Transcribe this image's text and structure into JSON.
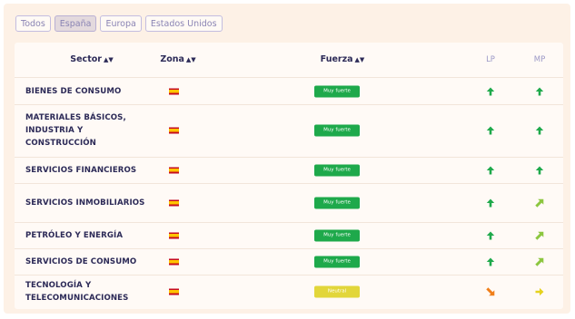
{
  "filters": [
    {
      "label": "Todos",
      "active": false
    },
    {
      "label": "España",
      "active": true
    },
    {
      "label": "Europa",
      "active": false
    },
    {
      "label": "Estados Unidos",
      "active": false
    }
  ],
  "table": {
    "headers": {
      "sector": "Sector",
      "zona": "Zona",
      "fuerza": "Fuerza",
      "lp": "LP",
      "mp": "MP"
    },
    "rows": [
      {
        "sector": "BIENES DE CONSUMO",
        "zone_flag": "spain-flag-icon",
        "fuerza": "Muy fuerte",
        "fuerza_color": "#1ea94b",
        "lp": "arrow-up",
        "mp": "arrow-up"
      },
      {
        "sector": "MATERIALES BÁSICOS, INDUSTRIA Y CONSTRUCCIÓN",
        "zone_flag": "spain-flag-icon",
        "fuerza": "Muy fuerte",
        "fuerza_color": "#1ea94b",
        "lp": "arrow-up",
        "mp": "arrow-up"
      },
      {
        "sector": "SERVICIOS FINANCIEROS",
        "zone_flag": "spain-flag-icon",
        "fuerza": "Muy fuerte",
        "fuerza_color": "#1ea94b",
        "lp": "arrow-up",
        "mp": "arrow-up"
      },
      {
        "sector": "SERVICIOS INMOBILIARIOS",
        "zone_flag": "spain-flag-icon",
        "fuerza": "Muy fuerte",
        "fuerza_color": "#1ea94b",
        "lp": "arrow-up",
        "mp": "arrow-up-right"
      },
      {
        "sector": "PETRÓLEO Y ENERGÍA",
        "zone_flag": "spain-flag-icon",
        "fuerza": "Muy fuerte",
        "fuerza_color": "#1ea94b",
        "lp": "arrow-up",
        "mp": "arrow-up-right"
      },
      {
        "sector": "SERVICIOS DE CONSUMO",
        "zone_flag": "spain-flag-icon",
        "fuerza": "Muy fuerte",
        "fuerza_color": "#1ea94b",
        "lp": "arrow-up",
        "mp": "arrow-up-right"
      },
      {
        "sector": "TECNOLOGÍA Y TELECOMUNICACIONES",
        "zone_flag": "spain-flag-icon",
        "fuerza": "Neutral",
        "fuerza_color": "#e2d63a",
        "lp": "arrow-down-right",
        "mp": "arrow-right"
      }
    ]
  },
  "colors": {
    "strong_green": "#1ea94b",
    "up_right_green": "#8cc63f",
    "down_right_orange": "#f07f1a",
    "right_yellow": "#e5d21e",
    "neutral_yellow": "#e2d63a",
    "text_navy": "#2c2a57",
    "background": "#fdf1e6"
  }
}
